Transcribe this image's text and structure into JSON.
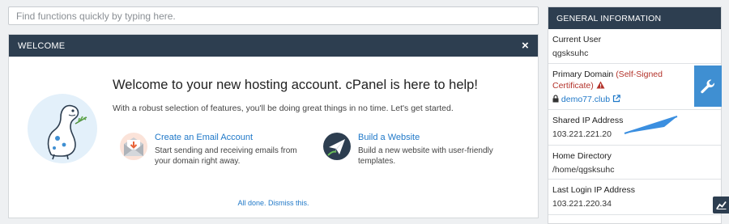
{
  "search": {
    "placeholder": "Find functions quickly by typing here."
  },
  "welcome": {
    "header": "WELCOME",
    "close_glyph": "×",
    "title": "Welcome to your new hosting account. cPanel is here to help!",
    "subtitle": "With a robust selection of features, you'll be doing great things in no time. Let's get started.",
    "features": [
      {
        "title": "Create an Email Account",
        "description": "Start sending and receiving emails from your domain right away.",
        "icon": "email-envelope-icon"
      },
      {
        "title": "Build a Website",
        "description": "Build a new website with user-friendly templates.",
        "icon": "paper-plane-icon"
      }
    ],
    "dismiss": "All done. Dismiss this."
  },
  "general_info": {
    "header": "GENERAL INFORMATION",
    "current_user": {
      "label": "Current User",
      "value": "qgsksuhc"
    },
    "primary_domain": {
      "label": "Primary Domain",
      "warning": "(Self-Signed Certificate)",
      "value": "demo77.club"
    },
    "shared_ip": {
      "label": "Shared IP Address",
      "value": "103.221.221.20"
    },
    "home_directory": {
      "label": "Home Directory",
      "value": "/home/qgsksuhc"
    },
    "last_login_ip": {
      "label": "Last Login IP Address",
      "value": "103.221.220.34"
    }
  },
  "colors": {
    "header_bg": "#2d3e50",
    "link": "#1f78c8",
    "warning": "#b3322a",
    "wrench_bg": "#3f8fd2",
    "arrow": "#3b8fe0"
  }
}
